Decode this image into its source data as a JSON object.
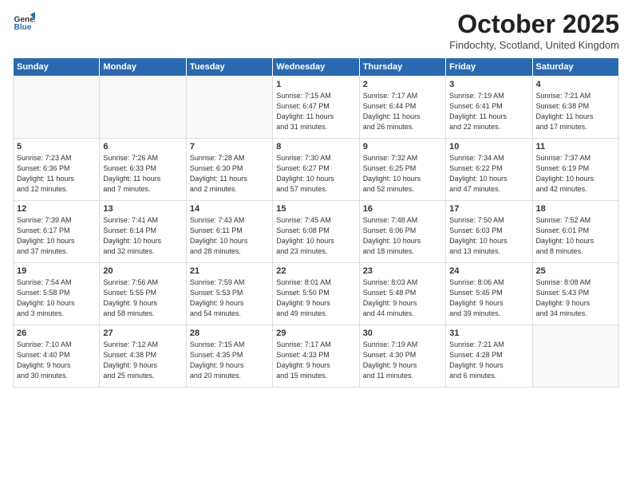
{
  "logo": {
    "line1": "General",
    "line2": "Blue"
  },
  "header": {
    "title": "October 2025",
    "location": "Findochty, Scotland, United Kingdom"
  },
  "weekdays": [
    "Sunday",
    "Monday",
    "Tuesday",
    "Wednesday",
    "Thursday",
    "Friday",
    "Saturday"
  ],
  "weeks": [
    [
      {
        "day": "",
        "info": ""
      },
      {
        "day": "",
        "info": ""
      },
      {
        "day": "",
        "info": ""
      },
      {
        "day": "1",
        "info": "Sunrise: 7:15 AM\nSunset: 6:47 PM\nDaylight: 11 hours\nand 31 minutes."
      },
      {
        "day": "2",
        "info": "Sunrise: 7:17 AM\nSunset: 6:44 PM\nDaylight: 11 hours\nand 26 minutes."
      },
      {
        "day": "3",
        "info": "Sunrise: 7:19 AM\nSunset: 6:41 PM\nDaylight: 11 hours\nand 22 minutes."
      },
      {
        "day": "4",
        "info": "Sunrise: 7:21 AM\nSunset: 6:38 PM\nDaylight: 11 hours\nand 17 minutes."
      }
    ],
    [
      {
        "day": "5",
        "info": "Sunrise: 7:23 AM\nSunset: 6:36 PM\nDaylight: 11 hours\nand 12 minutes."
      },
      {
        "day": "6",
        "info": "Sunrise: 7:26 AM\nSunset: 6:33 PM\nDaylight: 11 hours\nand 7 minutes."
      },
      {
        "day": "7",
        "info": "Sunrise: 7:28 AM\nSunset: 6:30 PM\nDaylight: 11 hours\nand 2 minutes."
      },
      {
        "day": "8",
        "info": "Sunrise: 7:30 AM\nSunset: 6:27 PM\nDaylight: 10 hours\nand 57 minutes."
      },
      {
        "day": "9",
        "info": "Sunrise: 7:32 AM\nSunset: 6:25 PM\nDaylight: 10 hours\nand 52 minutes."
      },
      {
        "day": "10",
        "info": "Sunrise: 7:34 AM\nSunset: 6:22 PM\nDaylight: 10 hours\nand 47 minutes."
      },
      {
        "day": "11",
        "info": "Sunrise: 7:37 AM\nSunset: 6:19 PM\nDaylight: 10 hours\nand 42 minutes."
      }
    ],
    [
      {
        "day": "12",
        "info": "Sunrise: 7:39 AM\nSunset: 6:17 PM\nDaylight: 10 hours\nand 37 minutes."
      },
      {
        "day": "13",
        "info": "Sunrise: 7:41 AM\nSunset: 6:14 PM\nDaylight: 10 hours\nand 32 minutes."
      },
      {
        "day": "14",
        "info": "Sunrise: 7:43 AM\nSunset: 6:11 PM\nDaylight: 10 hours\nand 28 minutes."
      },
      {
        "day": "15",
        "info": "Sunrise: 7:45 AM\nSunset: 6:08 PM\nDaylight: 10 hours\nand 23 minutes."
      },
      {
        "day": "16",
        "info": "Sunrise: 7:48 AM\nSunset: 6:06 PM\nDaylight: 10 hours\nand 18 minutes."
      },
      {
        "day": "17",
        "info": "Sunrise: 7:50 AM\nSunset: 6:03 PM\nDaylight: 10 hours\nand 13 minutes."
      },
      {
        "day": "18",
        "info": "Sunrise: 7:52 AM\nSunset: 6:01 PM\nDaylight: 10 hours\nand 8 minutes."
      }
    ],
    [
      {
        "day": "19",
        "info": "Sunrise: 7:54 AM\nSunset: 5:58 PM\nDaylight: 10 hours\nand 3 minutes."
      },
      {
        "day": "20",
        "info": "Sunrise: 7:56 AM\nSunset: 5:55 PM\nDaylight: 9 hours\nand 58 minutes."
      },
      {
        "day": "21",
        "info": "Sunrise: 7:59 AM\nSunset: 5:53 PM\nDaylight: 9 hours\nand 54 minutes."
      },
      {
        "day": "22",
        "info": "Sunrise: 8:01 AM\nSunset: 5:50 PM\nDaylight: 9 hours\nand 49 minutes."
      },
      {
        "day": "23",
        "info": "Sunrise: 8:03 AM\nSunset: 5:48 PM\nDaylight: 9 hours\nand 44 minutes."
      },
      {
        "day": "24",
        "info": "Sunrise: 8:06 AM\nSunset: 5:45 PM\nDaylight: 9 hours\nand 39 minutes."
      },
      {
        "day": "25",
        "info": "Sunrise: 8:08 AM\nSunset: 5:43 PM\nDaylight: 9 hours\nand 34 minutes."
      }
    ],
    [
      {
        "day": "26",
        "info": "Sunrise: 7:10 AM\nSunset: 4:40 PM\nDaylight: 9 hours\nand 30 minutes."
      },
      {
        "day": "27",
        "info": "Sunrise: 7:12 AM\nSunset: 4:38 PM\nDaylight: 9 hours\nand 25 minutes."
      },
      {
        "day": "28",
        "info": "Sunrise: 7:15 AM\nSunset: 4:35 PM\nDaylight: 9 hours\nand 20 minutes."
      },
      {
        "day": "29",
        "info": "Sunrise: 7:17 AM\nSunset: 4:33 PM\nDaylight: 9 hours\nand 15 minutes."
      },
      {
        "day": "30",
        "info": "Sunrise: 7:19 AM\nSunset: 4:30 PM\nDaylight: 9 hours\nand 11 minutes."
      },
      {
        "day": "31",
        "info": "Sunrise: 7:21 AM\nSunset: 4:28 PM\nDaylight: 9 hours\nand 6 minutes."
      },
      {
        "day": "",
        "info": ""
      }
    ]
  ]
}
